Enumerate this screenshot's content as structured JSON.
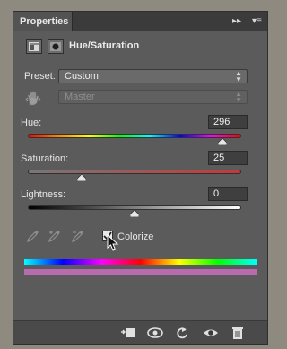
{
  "panel": {
    "tab_title": "Properties",
    "header_title": "Hue/Saturation"
  },
  "preset": {
    "label": "Preset:",
    "value": "Custom"
  },
  "channel": {
    "value": "Master"
  },
  "hue": {
    "label": "Hue:",
    "value": "296",
    "level": 0.911
  },
  "saturation": {
    "label": "Saturation:",
    "value": "25",
    "level": 0.25
  },
  "lightness": {
    "label": "Lightness:",
    "value": "0",
    "level": 0.5
  },
  "colorize": {
    "label": "Colorize",
    "checked": true
  },
  "icons": {
    "header": [
      "adjustment-layer-icon",
      "mask-icon"
    ],
    "eyedroppers": [
      "eyedropper-icon",
      "eyedropper-plus-icon",
      "eyedropper-minus-icon"
    ],
    "footer": [
      "clip-to-layer-icon",
      "view-previous-icon",
      "reset-icon",
      "visibility-icon",
      "trash-icon"
    ]
  },
  "colors": {
    "panel_bg": "#5b5b5b",
    "saturation_track": "#c23a3a",
    "colorize_bar": "#b76cb0"
  }
}
